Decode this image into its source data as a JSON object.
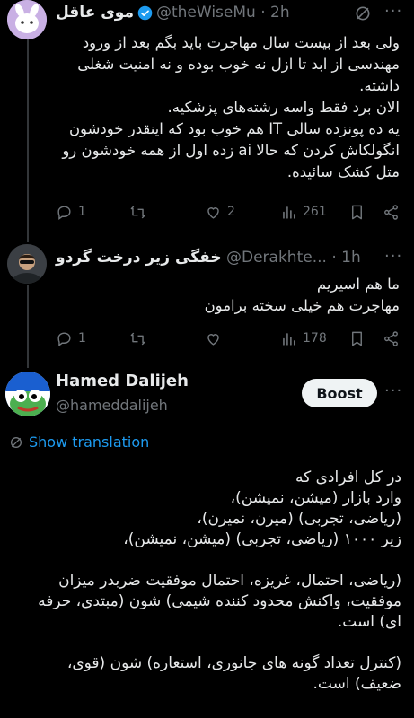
{
  "tweet1": {
    "name": "موی عاقل",
    "handle": "@theWiseMu",
    "time": "2h",
    "body": [
      "ولی بعد از بیست سال مهاجرت باید بگم بعد از ورود",
      "مهندسی از ابد تا ازل نه خوب بوده و نه امنیت شغلی",
      "داشته.",
      "الان برد فقط واسه رشته‌های پزشکیه.",
      "یه ده پونزده سالی IT هم خوب بود که اینقدر خودشون",
      "انگولکاش کردن که حالا ai زده اول از همه خودشون رو",
      "متل کشک سائیده."
    ],
    "replies": "1",
    "likes": "2",
    "views": "261"
  },
  "tweet2": {
    "name": "خفگی زیر درخت گردو",
    "handle": "@Derakhte...",
    "time": "1h",
    "body": [
      "ما هم اسیریم",
      "مهاجرت هم خیلی سخته برامون"
    ],
    "replies": "1",
    "views": "178"
  },
  "tweet3": {
    "name": "Hamed Dalijeh",
    "handle": "@hameddalijeh",
    "boost_label": "Boost",
    "show_translation": "Show translation",
    "body": [
      "در کل افرادی که",
      "وارد بازار (میشن، نمیشن)،",
      "(ریاضی، تجربی) (میرن، نمیرن)،",
      "زیر ۱۰۰۰ (ریاضی، تجربی) (میشن، نمیشن)،",
      "",
      "(ریاضی، احتمال، غریزه، احتمال موفقیت ضربدر میزان",
      "موفقیت، واکنش محدود کننده شیمی) شون (مبتدی، حرفه",
      "ای) است.",
      "",
      "(کنترل تعداد گونه های جانوری، استعاره) شون (قوی،",
      "ضعیف) است."
    ]
  },
  "colors": {
    "background": "#000000",
    "text": "#e7e9ea",
    "muted": "#71767b",
    "accent": "#1d9bf0"
  }
}
